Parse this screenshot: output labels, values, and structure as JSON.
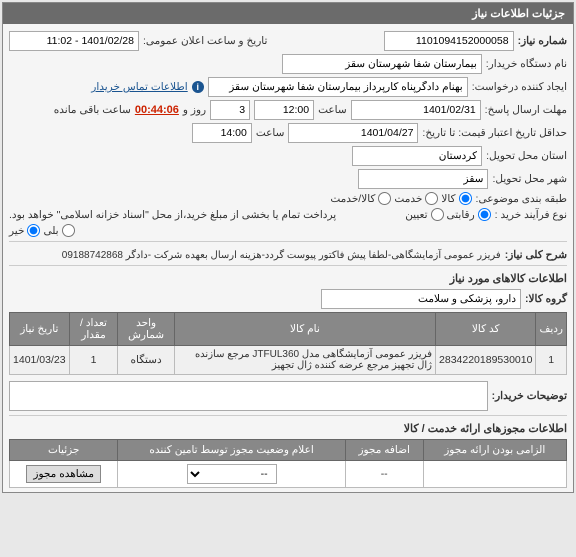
{
  "header": {
    "title": "جزئیات اطلاعات نیاز"
  },
  "fields": {
    "need_number_label": "شماره نیاز:",
    "need_number": "1101094152000058",
    "public_datetime_label": "تاریخ و ساعت اعلان عمومی:",
    "public_datetime": "1401/02/28 - 11:02",
    "buyer_label": "نام دستگاه خریدار:",
    "buyer": "بیمارستان شفا شهرستان سقز",
    "requester_label": "ایجاد کننده درخواست:",
    "requester": "بهنام دادگرپناه کارپرداز بیمارستان شفا شهرستان سقز",
    "contact_link": "اطلاعات تماس خریدار",
    "reply_deadline_label": "مهلت ارسال پاسخ:",
    "reply_date": "1401/02/31",
    "time_label": "ساعت",
    "reply_time": "12:00",
    "remaining_days": "3",
    "day_and_label": "روز و",
    "remaining_time": "00:44:06",
    "remaining_label": "ساعت باقی مانده",
    "validity_label": "حداقل تاریخ اعتبار قیمت: تا تاریخ:",
    "validity_date": "1401/04/27",
    "validity_time": "14:00",
    "province_label": "استان محل تحویل:",
    "province": "کردستان",
    "city_label": "شهر محل تحویل:",
    "city": "سقز",
    "budget_label": "طبقه بندی موضوعی:",
    "budget_opts": {
      "a": "کالا",
      "b": "خدمت",
      "c": "کالا/خدمت"
    },
    "purchase_type_label": "نوع فرآیند خرید :",
    "purchase_opts": {
      "a": "رقابتی",
      "b": "تعیین"
    },
    "payment_note": "پرداخت تمام یا بخشی از مبلغ خرید،از محل \"اسناد خزانه اسلامی\" خواهد بود.",
    "yesno": {
      "yes": "بلی",
      "no": "خیر"
    }
  },
  "desc": {
    "label": "شرح کلی نیاز:",
    "text": "فریزر عمومی آزمایشگاهی-لطفا پیش فاکتور پیوست گردد-هزینه ارسال بعهده شرکت -دادگر 09188742868"
  },
  "goods_section": {
    "title": "اطلاعات کالاهای مورد نیاز",
    "group_label": "گروه کالا:",
    "group_value": "دارو، پزشکی و سلامت"
  },
  "table": {
    "headers": {
      "row": "ردیف",
      "code": "کد کالا",
      "name": "نام کالا",
      "unit": "واحد شمارش",
      "qty": "تعداد / مقدار",
      "date": "تاریخ نیاز"
    },
    "rows": [
      {
        "row": "1",
        "code": "2834220189530010",
        "name": "فریزر عمومی آزمایشگاهی مدل JTFUL360 مرجع سازنده ژال تجهیز مرجع عرضه کننده ژال تجهیز",
        "unit": "دستگاه",
        "qty": "1",
        "date": "1401/03/23"
      }
    ]
  },
  "buyer_notes_label": "توضیحات خریدار:",
  "permits_section": {
    "title": "اطلاعات مجوزهای ارائه خدمت / کالا",
    "headers": {
      "mandatory": "الزامی بودن ارائه مجوز",
      "add": "اضافه مجوز",
      "status": "اعلام وضعیت مجوز توسط تامین کننده",
      "details": "جزئیات"
    },
    "status_placeholder": "--",
    "view_btn": "مشاهده مجوز"
  }
}
